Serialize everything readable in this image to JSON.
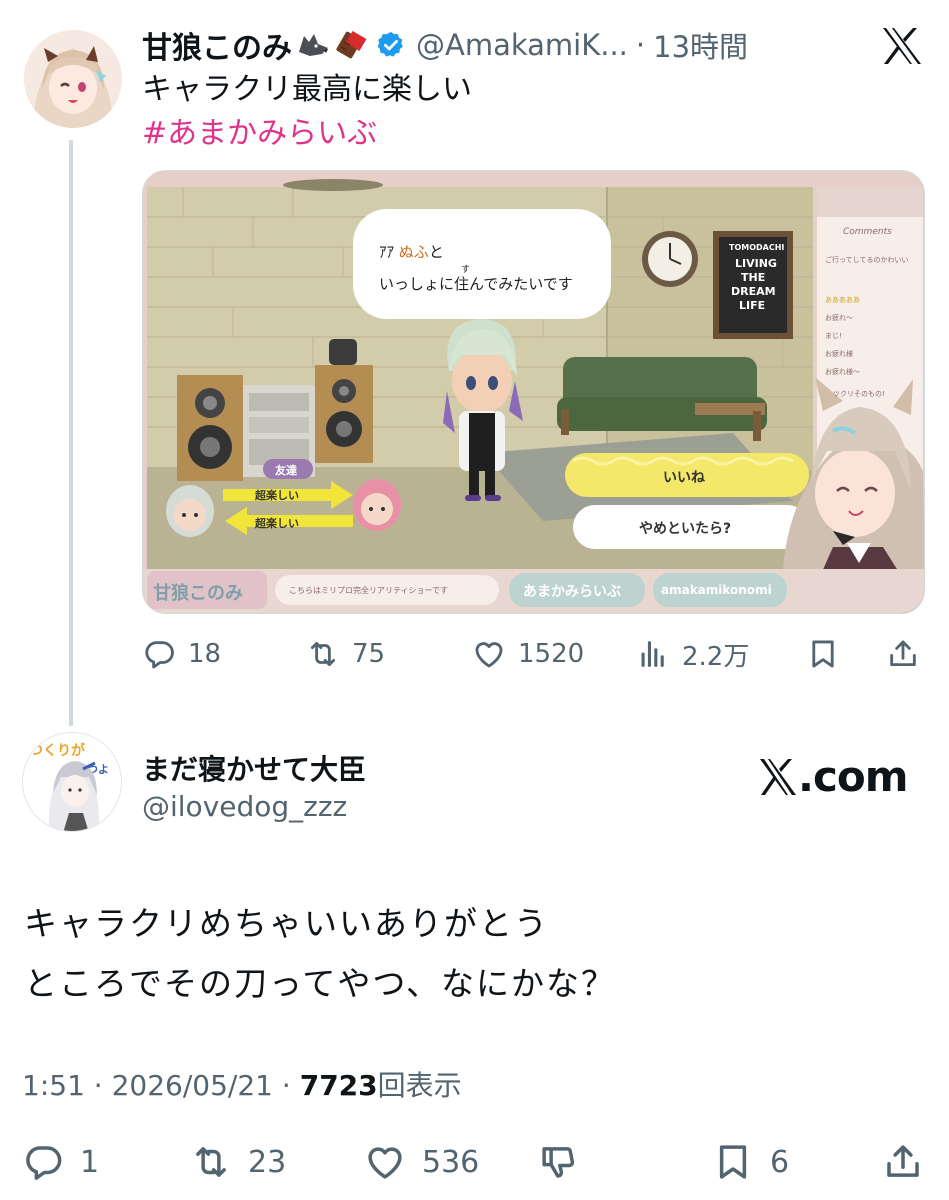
{
  "original_tweet": {
    "author_name": "甘狼このみ",
    "author_handle": "@AmakamiK...",
    "separator": "·",
    "time_ago": "13時間",
    "text": "キャラクリ最高に楽しい",
    "hashtag": "#あまかみらいぶ",
    "media": {
      "speech_line_1_prefix": "ｱｱ",
      "speech_line_1_name": "ぬふ",
      "speech_line_1_suffix": "と",
      "speech_furigana": "す",
      "speech_line_2": "いっしょに住んでみたいです",
      "friend_tag": "友達",
      "arrow_label_top": "超楽しい",
      "arrow_label_bottom": "超楽しい",
      "choice_1": "いいね",
      "choice_2": "やめといたら?",
      "poster_line1": "TOMODACHI",
      "poster_line2": "LIVING",
      "poster_line3": "THE",
      "poster_line4": "DREAM",
      "poster_line5": "LIFE",
      "comments_title": "Comments",
      "comments": [
        "ご行ってしてるのかわいい",
        "あああああ",
        "お疲れ〜",
        "まじ!",
        "お疲れ様",
        "お疲れ様〜",
        "ツクリそのもの!"
      ],
      "footer_logo": "甘狼このみ",
      "footer_note": "こちらはミリプロ完全リアリティショーです",
      "footer_hashtag": "あまかみらいぶ",
      "footer_handle": "amakamikonomi"
    },
    "stats": {
      "replies": "18",
      "reposts": "75",
      "likes": "1520",
      "views": "2.2万"
    }
  },
  "reply_tweet": {
    "author_name": "まだ寝かせて大臣",
    "author_handle": "@ilovedog_zzz",
    "text_line1": "キャラクリめちゃいいありがとう",
    "text_line2": "ところでその刀ってやつ、なにかな？",
    "time": "1:51",
    "date": "2026/05/21",
    "views": "7723",
    "views_label": "回表示",
    "stats": {
      "replies": "1",
      "reposts": "23",
      "likes": "536",
      "bookmarks": "6"
    }
  },
  "branding": {
    "xcom_text": ".com"
  },
  "icons": {
    "top_logo": "x-logo-icon",
    "verified": "verified-badge-icon",
    "reply": "reply-icon",
    "repost": "repost-icon",
    "like": "heart-icon",
    "views": "views-chart-icon",
    "bookmark": "bookmark-icon",
    "share": "share-icon",
    "dislike": "dislike-icon"
  },
  "colors": {
    "hashtag": "#e0348c",
    "secondary_text": "#536471",
    "verified_blue": "#1d9bf0",
    "thread_line": "#cfd9de"
  }
}
